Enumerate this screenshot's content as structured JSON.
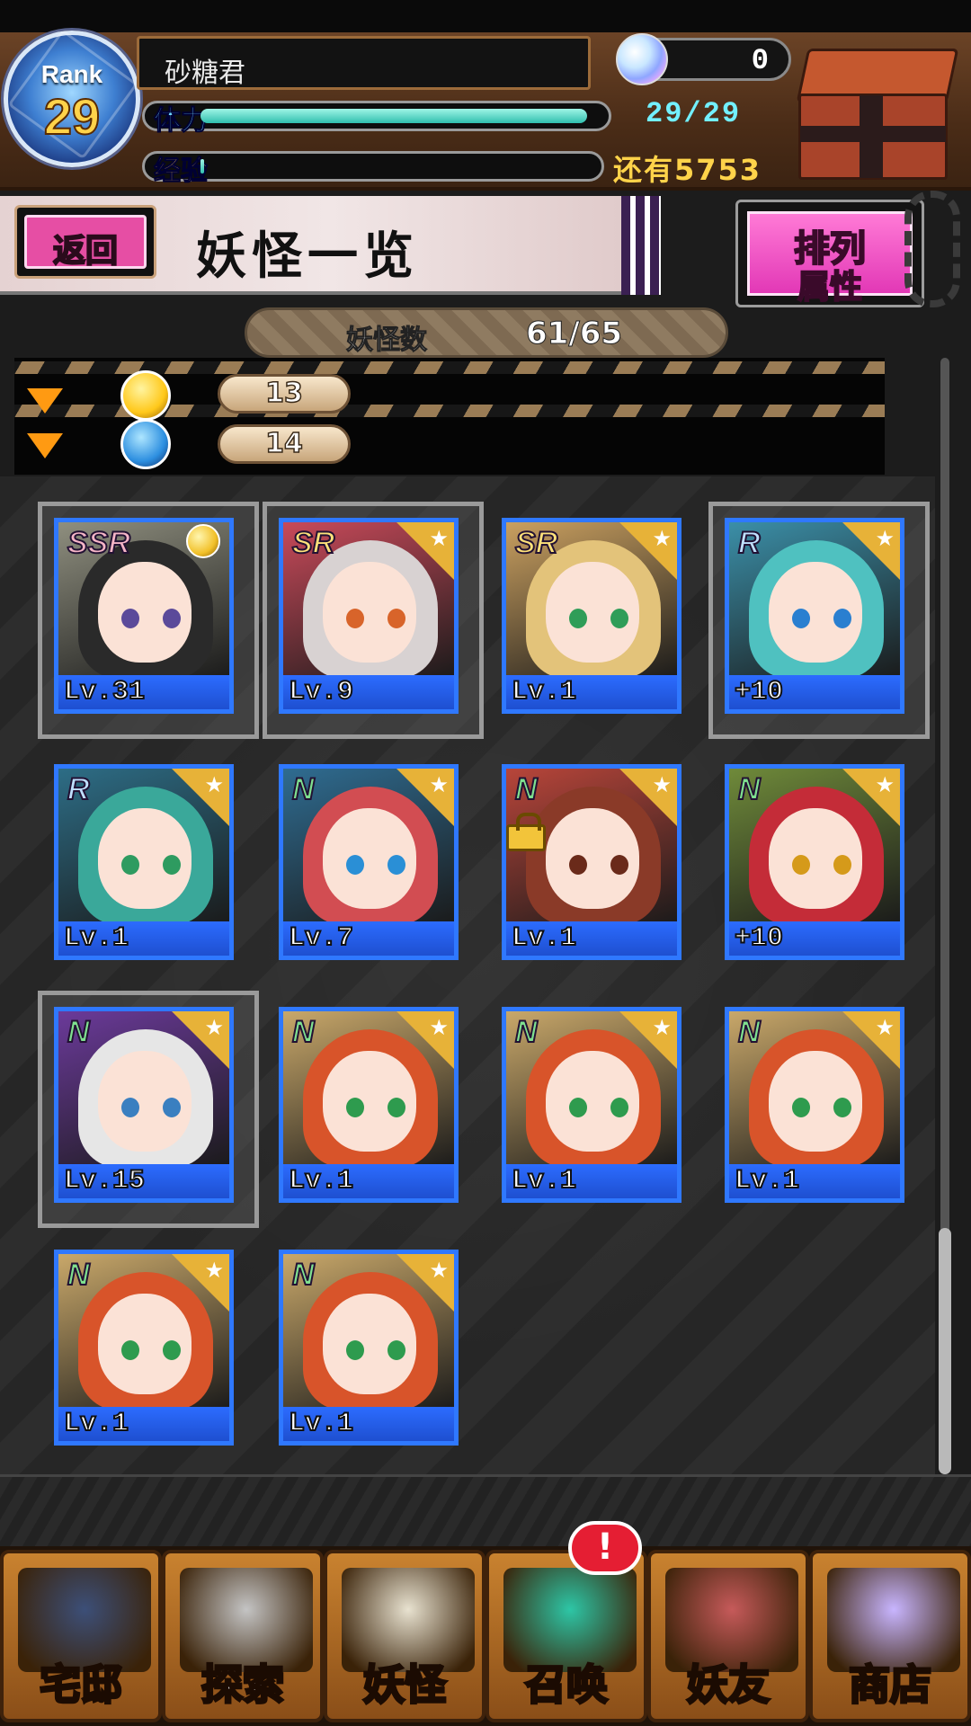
{
  "header": {
    "rank_label": "Rank",
    "rank_value": "29",
    "player_name": "砂糖君",
    "gems": "0",
    "stamina_label": "体力",
    "stamina_value": "29/29",
    "stamina_fill": 1.0,
    "exp_label": "经验",
    "exp_remaining": "还有5753",
    "exp_fill": 0.0
  },
  "title_bar": {
    "back_label": "返回",
    "title": "妖怪一览",
    "sort_line1": "排列",
    "sort_line2": "属性"
  },
  "count_bar": {
    "label": "妖怪数",
    "value": "61/65"
  },
  "filters": [
    {
      "icon": "gold-attribute-icon",
      "count": "13"
    },
    {
      "icon": "blue-attribute-icon",
      "count": "14"
    }
  ],
  "cards": [
    {
      "rarity": "SSR",
      "level": "Lv.31",
      "hair": "#2a2a2a",
      "bg": "#8f8f7f",
      "eye": "#5b4a9a",
      "highlight": true,
      "medal": true,
      "lock": false
    },
    {
      "rarity": "SR",
      "level": "Lv.9",
      "hair": "#d8d2d2",
      "bg": "#c94a5a",
      "eye": "#d8642a",
      "highlight": true,
      "medal": false,
      "lock": false
    },
    {
      "rarity": "SR",
      "level": "Lv.1",
      "hair": "#e3c37a",
      "bg": "#caa060",
      "eye": "#2f9d58",
      "highlight": false,
      "medal": false,
      "lock": false
    },
    {
      "rarity": "R",
      "level": "+10",
      "hair": "#4fc1c0",
      "bg": "#3b8fa8",
      "eye": "#2a7fd0",
      "highlight": true,
      "medal": false,
      "lock": false
    },
    {
      "rarity": "R",
      "level": "Lv.1",
      "hair": "#3aa89a",
      "bg": "#2d6d86",
      "eye": "#2e9b60",
      "highlight": false,
      "medal": false,
      "lock": false
    },
    {
      "rarity": "N",
      "level": "Lv.7",
      "hair": "#d24d52",
      "bg": "#2f6c91",
      "eye": "#2a8fd6",
      "highlight": false,
      "medal": false,
      "lock": false
    },
    {
      "rarity": "N",
      "level": "Lv.1",
      "hair": "#8a3a28",
      "bg": "#b8453a",
      "eye": "#6a2a1a",
      "highlight": false,
      "medal": false,
      "lock": true
    },
    {
      "rarity": "N",
      "level": "+10",
      "hair": "#c42c38",
      "bg": "#6f8a3a",
      "eye": "#d59a1a",
      "highlight": false,
      "medal": false,
      "lock": false
    },
    {
      "rarity": "N",
      "level": "Lv.15",
      "hair": "#e6e6e6",
      "bg": "#6b3a9a",
      "eye": "#3a7fc0",
      "highlight": true,
      "medal": false,
      "lock": false
    },
    {
      "rarity": "N",
      "level": "Lv.1",
      "hair": "#d8542a",
      "bg": "#c9a86a",
      "eye": "#2e9b4e",
      "highlight": false,
      "medal": false,
      "lock": false
    },
    {
      "rarity": "N",
      "level": "Lv.1",
      "hair": "#d8542a",
      "bg": "#c9a86a",
      "eye": "#2e9b4e",
      "highlight": false,
      "medal": false,
      "lock": false
    },
    {
      "rarity": "N",
      "level": "Lv.1",
      "hair": "#d8542a",
      "bg": "#c9a86a",
      "eye": "#2e9b4e",
      "highlight": false,
      "medal": false,
      "lock": false
    },
    {
      "rarity": "N",
      "level": "Lv.1",
      "hair": "#d8542a",
      "bg": "#c9a86a",
      "eye": "#2e9b4e",
      "highlight": false,
      "medal": false,
      "lock": false
    },
    {
      "rarity": "N",
      "level": "Lv.1",
      "hair": "#d8542a",
      "bg": "#c9a86a",
      "eye": "#2e9b4e",
      "highlight": false,
      "medal": false,
      "lock": false
    }
  ],
  "rarity_colors": {
    "SSR": "#f5b5c7",
    "SR": "#ffe27a",
    "R": "#bfe0ff",
    "N": "#7fe08f"
  },
  "nav": [
    {
      "label": "宅邸",
      "icon": "mansion-icon",
      "art": "#3c4f78"
    },
    {
      "label": "探索",
      "icon": "magnifier-icon",
      "art": "#c4c4c4"
    },
    {
      "label": "妖怪",
      "icon": "scroll-icon",
      "art": "#e8e2d0"
    },
    {
      "label": "召唤",
      "icon": "pentagram-icon",
      "art": "#2dc6a6"
    },
    {
      "label": "妖友",
      "icon": "friend-avatar-icon",
      "art": "#c65a5a"
    },
    {
      "label": "商店",
      "icon": "crystal-orb-icon",
      "art": "#c8b5ff"
    }
  ],
  "summon_badge": "!"
}
